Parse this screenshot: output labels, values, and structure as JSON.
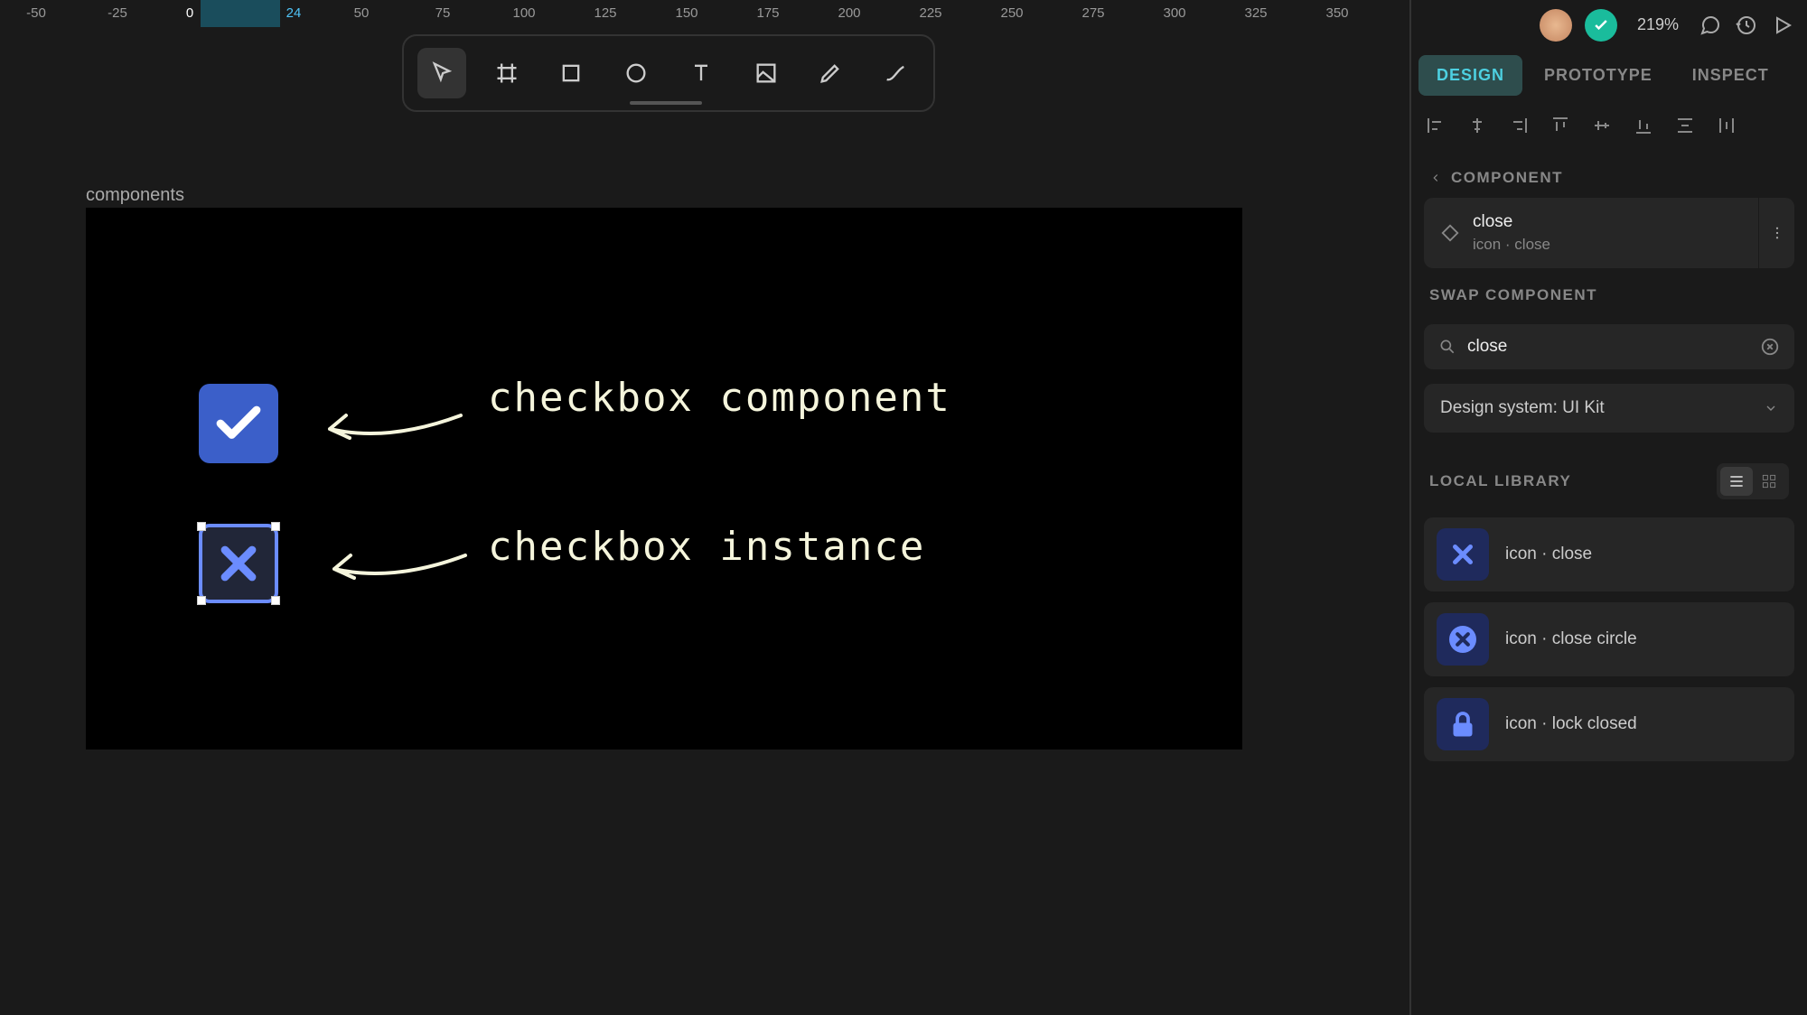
{
  "ruler": {
    "ticks": [
      "-50",
      "-25",
      "0",
      "24",
      "50",
      "75",
      "100",
      "125",
      "150",
      "175",
      "200",
      "225",
      "250",
      "275",
      "300",
      "325",
      "350"
    ],
    "current": "24"
  },
  "zoom": "219%",
  "tabs": [
    "DESIGN",
    "PROTOTYPE",
    "INSPECT"
  ],
  "frame_label": "components",
  "annot1": "checkbox component",
  "annot2": "checkbox instance",
  "section_component": "COMPONENT",
  "comp": {
    "name": "close",
    "sub": "icon · close"
  },
  "swap_label": "SWAP COMPONENT",
  "search": {
    "value": "close"
  },
  "lib_select": "Design system: UI Kit",
  "local_lib": "LOCAL LIBRARY",
  "items": [
    {
      "label": "icon · close",
      "type": "x"
    },
    {
      "label": "icon · close circle",
      "type": "xcircle"
    },
    {
      "label": "icon · lock closed",
      "type": "lock"
    }
  ]
}
